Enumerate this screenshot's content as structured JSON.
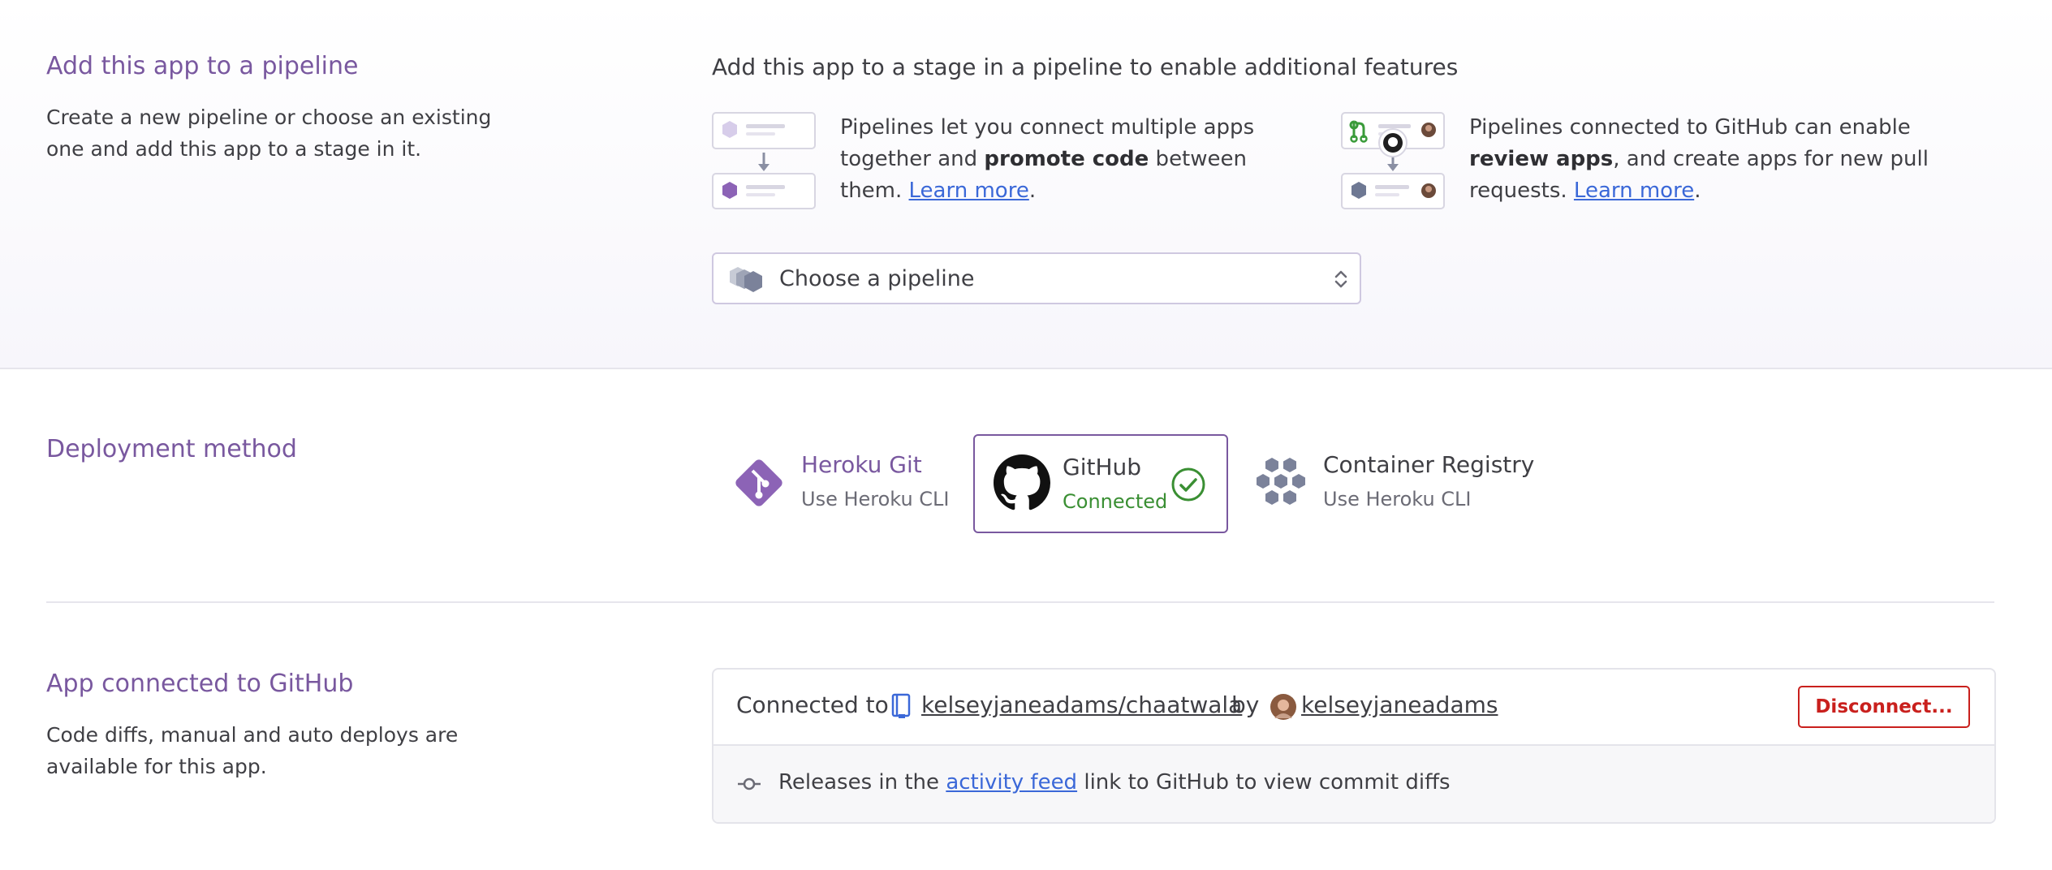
{
  "pipeline": {
    "title": "Add this app to a pipeline",
    "description": "Create a new pipeline or choose an existing one and add this app to a stage in it.",
    "heading": "Add this app to a stage in a pipeline to enable additional features",
    "feature1": {
      "text_a": "Pipelines let you connect multiple apps together and ",
      "bold": "promote code",
      "text_b": " between them.",
      "link": "Learn more",
      "after_link": "."
    },
    "feature2": {
      "text_a": "Pipelines connected to GitHub can enable ",
      "bold": "review apps",
      "text_b": ", and create apps for new pull requests.",
      "link": "Learn more",
      "after_link": "."
    },
    "select_label": "Choose a pipeline"
  },
  "deploy": {
    "title": "Deployment method",
    "options": [
      {
        "name": "Heroku Git",
        "sub": "Use Heroku CLI",
        "icon": "heroku-git-icon"
      },
      {
        "name": "GitHub",
        "sub": "Connected",
        "icon": "github-icon"
      },
      {
        "name": "Container Registry",
        "sub": "Use Heroku CLI",
        "icon": "container-registry-icon"
      }
    ]
  },
  "github": {
    "title": "App connected to GitHub",
    "description": "Code diffs, manual and auto deploys are available for this app.",
    "connected_to": "Connected to",
    "repo": "kelseyjaneadams/chaatwala",
    "by": "by",
    "user": "kelseyjaneadams",
    "disconnect": "Disconnect...",
    "releases_prefix": "Releases in the ",
    "activity_link": "activity feed",
    "releases_suffix": " link to GitHub to view commit diffs"
  },
  "colors": {
    "accent_purple": "#79589f",
    "link_blue": "#3b68d8",
    "connected_green": "#3a8f33",
    "danger_red": "#c9201d"
  }
}
